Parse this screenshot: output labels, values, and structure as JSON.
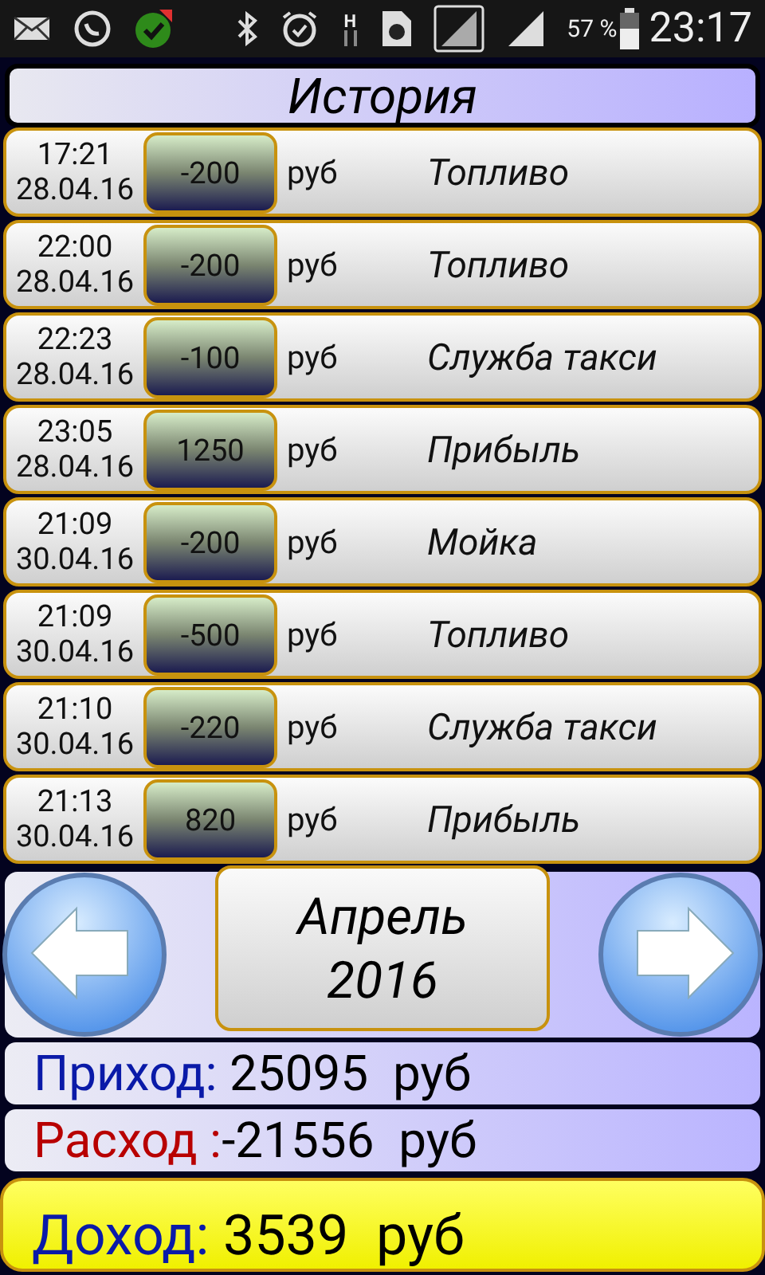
{
  "status_bar": {
    "network": "H",
    "battery": "57 %",
    "time": "23:17"
  },
  "title": "История",
  "rows": [
    {
      "time": "17:21",
      "date": "28.04.16",
      "amount": "-200",
      "currency": "руб",
      "category": "Топливо"
    },
    {
      "time": "22:00",
      "date": "28.04.16",
      "amount": "-200",
      "currency": "руб",
      "category": "Топливо"
    },
    {
      "time": "22:23",
      "date": "28.04.16",
      "amount": "-100",
      "currency": "руб",
      "category": "Служба такси"
    },
    {
      "time": "23:05",
      "date": "28.04.16",
      "amount": "1250",
      "currency": "руб",
      "category": "Прибыль"
    },
    {
      "time": "21:09",
      "date": "30.04.16",
      "amount": "-200",
      "currency": "руб",
      "category": "Мойка"
    },
    {
      "time": "21:09",
      "date": "30.04.16",
      "amount": "-500",
      "currency": "руб",
      "category": "Топливо"
    },
    {
      "time": "21:10",
      "date": "30.04.16",
      "amount": "-220",
      "currency": "руб",
      "category": "Служба такси"
    },
    {
      "time": "21:13",
      "date": "30.04.16",
      "amount": "820",
      "currency": "руб",
      "category": "Прибыль"
    }
  ],
  "period": {
    "month": "Апрель",
    "year": "2016"
  },
  "summary": [
    {
      "kind": "income",
      "label": "Приход:",
      "value": " 25095  руб"
    },
    {
      "kind": "expense",
      "label": "Расход :",
      "value": "-21556  руб"
    },
    {
      "kind": "profit",
      "label": "Доход:",
      "value": " 3539  руб"
    }
  ]
}
